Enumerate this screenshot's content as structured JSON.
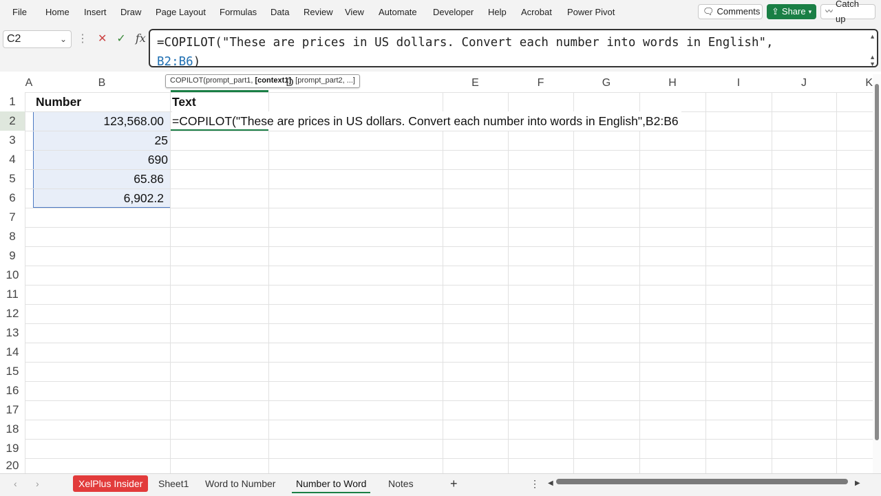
{
  "menu": [
    "File",
    "Home",
    "Insert",
    "Draw",
    "Page Layout",
    "Formulas",
    "Data",
    "Review",
    "View",
    "Automate",
    "Developer",
    "Help",
    "Acrobat",
    "Power Pivot"
  ],
  "top_buttons": {
    "comments": "Comments",
    "share": "Share",
    "catchup": "Catch up"
  },
  "namebox": "C2",
  "formula_icons": {
    "cancel": "✕",
    "enter": "✓",
    "fx": "fx"
  },
  "formula": {
    "line1": "=COPILOT(\"These are prices in US dollars. Convert each number into words in English\",",
    "line2_ref": "B2:B6",
    "line2_end": ")"
  },
  "tooltip": {
    "fn": "COPILOT(prompt_part1, ",
    "bold": "[context1]",
    "rest": ", [prompt_part2, ...]"
  },
  "columns": [
    "A",
    "B",
    "C",
    "D",
    "E",
    "F",
    "G",
    "H",
    "I",
    "J",
    "K"
  ],
  "rows": [
    "1",
    "2",
    "3",
    "4",
    "5",
    "6",
    "7",
    "8",
    "9",
    "10",
    "11",
    "12",
    "13",
    "14",
    "15",
    "16",
    "17",
    "18",
    "19",
    "20"
  ],
  "cells": {
    "B1": "Number",
    "C1": "Text",
    "B2": "123,568.00",
    "B3": "25",
    "B4": "690",
    "B5": "65.86",
    "B6": "6,902.2",
    "C2": "=COPILOT(\"These are prices in US dollars. Convert each number into words in English\",B2:B6"
  },
  "sheet_tabs": [
    "XelPlus Insider",
    "Sheet1",
    "Word to Number",
    "Number to Word",
    "Notes"
  ],
  "active_sheet": "Number to Word",
  "colors": {
    "accent": "#1a7f45",
    "selection": "#e8eef8",
    "insider_tab": "#e23b3b",
    "ref_blue": "#1f6fb2"
  }
}
